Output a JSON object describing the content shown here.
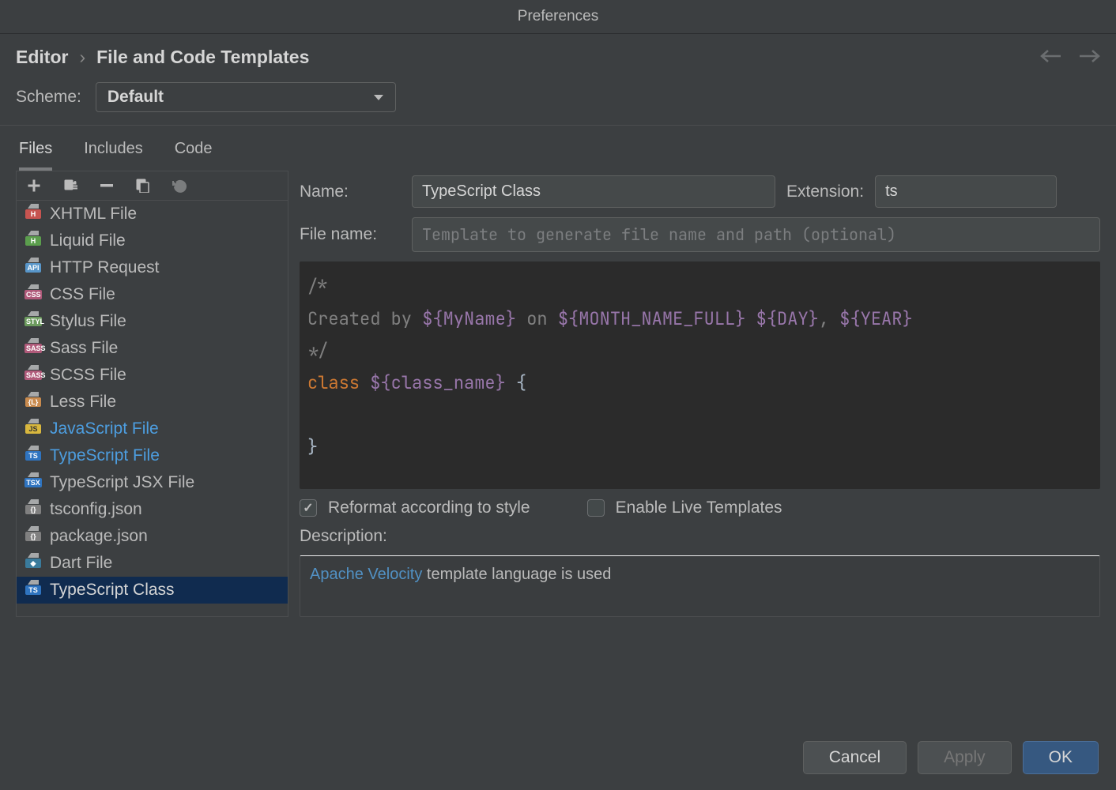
{
  "window": {
    "title": "Preferences"
  },
  "breadcrumb": {
    "part1": "Editor",
    "part2": "File and Code Templates"
  },
  "scheme": {
    "label": "Scheme:",
    "value": "Default"
  },
  "tabs": [
    {
      "label": "Files",
      "active": true
    },
    {
      "label": "Includes",
      "active": false
    },
    {
      "label": "Code",
      "active": false
    }
  ],
  "toolbar_icons": [
    "add",
    "copy",
    "remove",
    "duplicate",
    "revert"
  ],
  "files": [
    {
      "label": "XHTML File",
      "badge": "H",
      "bg": "#c75450",
      "fg": "#fff"
    },
    {
      "label": "Liquid File",
      "badge": "H",
      "bg": "#5b9e4d",
      "fg": "#fff"
    },
    {
      "label": "HTTP Request",
      "badge": "API",
      "bg": "#5896c9",
      "fg": "#fff"
    },
    {
      "label": "CSS File",
      "badge": "CSS",
      "bg": "#b05a7a",
      "fg": "#fff"
    },
    {
      "label": "Stylus File",
      "badge": "STYL",
      "bg": "#6c9b5e",
      "fg": "#fff"
    },
    {
      "label": "Sass File",
      "badge": "SASS",
      "bg": "#b05a7a",
      "fg": "#fff"
    },
    {
      "label": "SCSS File",
      "badge": "SASS",
      "bg": "#b05a7a",
      "fg": "#fff"
    },
    {
      "label": "Less File",
      "badge": "{L}",
      "bg": "#c98b4e",
      "fg": "#fff"
    },
    {
      "label": "JavaScript File",
      "badge": "JS",
      "bg": "#d8b73e",
      "fg": "#333",
      "modified": true
    },
    {
      "label": "TypeScript File",
      "badge": "TS",
      "bg": "#2f74c0",
      "fg": "#fff",
      "modified": true
    },
    {
      "label": "TypeScript JSX File",
      "badge": "TSX",
      "bg": "#2f74c0",
      "fg": "#fff"
    },
    {
      "label": "tsconfig.json",
      "badge": "{}",
      "bg": "#808080",
      "fg": "#fff"
    },
    {
      "label": "package.json",
      "badge": "{}",
      "bg": "#808080",
      "fg": "#fff"
    },
    {
      "label": "Dart File",
      "badge": "◆",
      "bg": "#3a7b9c",
      "fg": "#fff"
    },
    {
      "label": "TypeScript Class",
      "badge": "TS",
      "bg": "#2f74c0",
      "fg": "#fff",
      "selected": true
    }
  ],
  "form": {
    "name_label": "Name:",
    "name_value": "TypeScript Class",
    "ext_label": "Extension:",
    "ext_value": "ts",
    "filename_label": "File name:",
    "filename_placeholder": "Template to generate file name and path (optional)"
  },
  "code": {
    "l1": "/*",
    "l2a": "Created by ",
    "l2b": "${MyName}",
    "l2c": " on ",
    "l2d": "${MONTH_NAME_FULL}",
    "l2e": " ",
    "l2f": "${DAY}",
    "l2g": ", ",
    "l2h": "${YEAR}",
    "l3": "*/",
    "l4a": "class",
    "l4b": " ",
    "l4c": "${class_name}",
    "l4d": " {",
    "l6": "}"
  },
  "checks": {
    "reformat": {
      "label": "Reformat according to style",
      "checked": true
    },
    "live": {
      "label": "Enable Live Templates",
      "checked": false
    }
  },
  "description": {
    "label": "Description:",
    "link": "Apache Velocity",
    "rest": " template language is used"
  },
  "buttons": {
    "cancel": "Cancel",
    "apply": "Apply",
    "ok": "OK"
  }
}
